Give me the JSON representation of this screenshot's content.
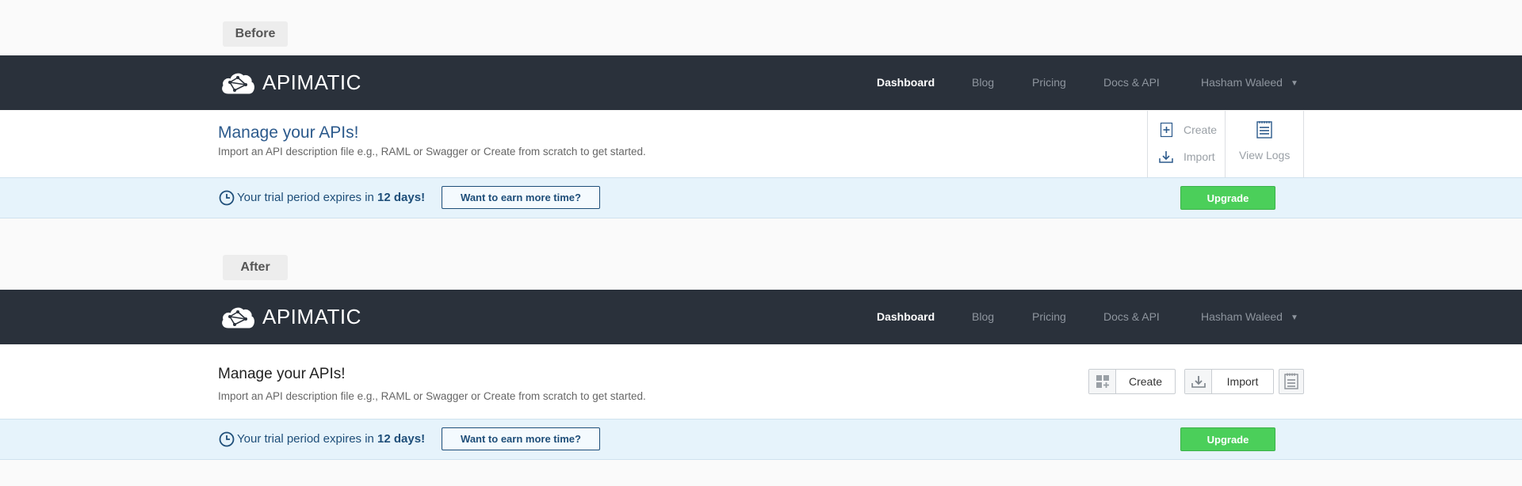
{
  "before": {
    "tag": "Before",
    "brand": "APIMATIC",
    "nav": {
      "dashboard": "Dashboard",
      "blog": "Blog",
      "pricing": "Pricing",
      "docs": "Docs & API",
      "user": "Hasham Waleed"
    },
    "title": "Manage your APIs!",
    "subtitle": "Import an API description file e.g., RAML or Swagger or Create from scratch to get started.",
    "actions": {
      "create": "Create",
      "import": "Import",
      "view_logs": "View Logs"
    },
    "trial": {
      "prefix": "Your trial period expires in ",
      "days": "12 days!",
      "earn": "Want to earn more time?",
      "upgrade": "Upgrade"
    }
  },
  "after": {
    "tag": "After",
    "brand": "APIMATIC",
    "nav": {
      "dashboard": "Dashboard",
      "blog": "Blog",
      "pricing": "Pricing",
      "docs": "Docs & API",
      "user": "Hasham Waleed"
    },
    "title": "Manage your APIs!",
    "subtitle": "Import an API description file e.g., RAML or Swagger or Create from scratch to get started.",
    "actions": {
      "create": "Create",
      "import": "Import"
    },
    "trial": {
      "prefix": "Your trial period expires in ",
      "days": "12 days!",
      "earn": "Want to earn more time?",
      "upgrade": "Upgrade"
    }
  },
  "icons": {
    "logo": "cloud-network-icon",
    "clock": "clock-icon",
    "create": "plus-icon",
    "import": "download-icon",
    "logs": "log-notepad-icon",
    "grid_add": "grid-add-icon",
    "caret": "caret-down-icon"
  },
  "colors": {
    "navbar": "#2a313b",
    "trial_bg": "#e6f3fb",
    "trial_text": "#1e4e79",
    "upgrade": "#4bcf5a",
    "title_before": "#2c5a8c"
  }
}
